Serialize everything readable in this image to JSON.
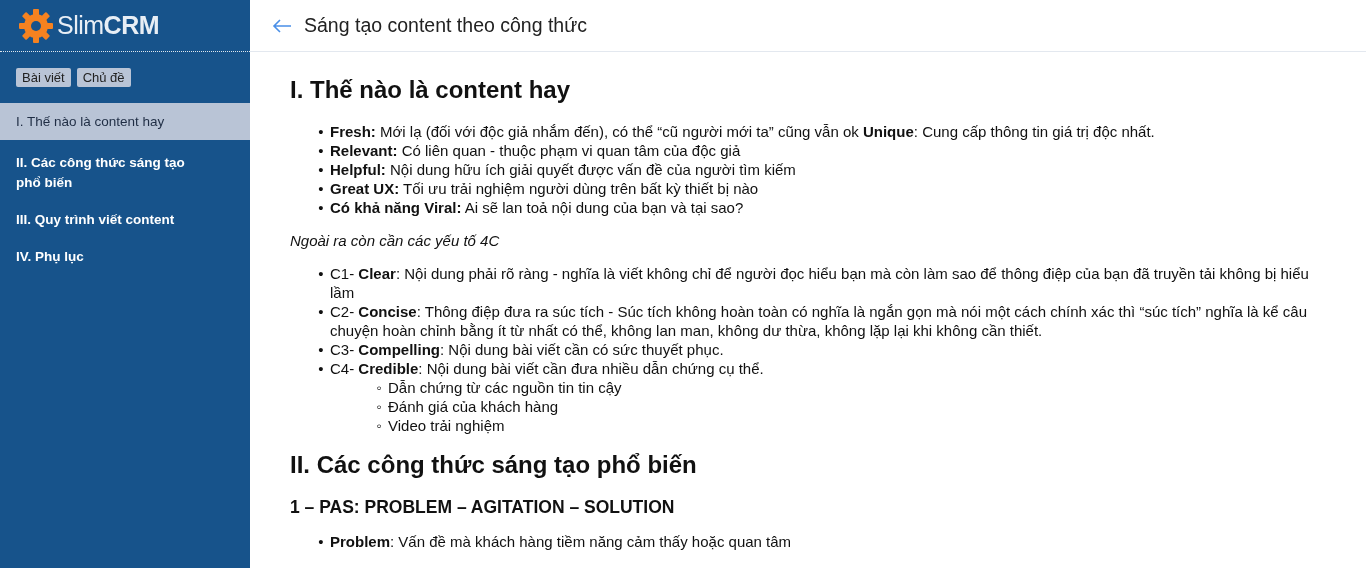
{
  "sidebar": {
    "logo": {
      "light": "Slim",
      "bold": "CRM"
    },
    "tabs": [
      {
        "label": "Bài viết"
      },
      {
        "label": "Chủ đề"
      }
    ],
    "items": [
      {
        "label": "I. Thế nào là content hay",
        "selected": true
      },
      {
        "label": "II. Các công thức sáng tạo phổ biến",
        "selected": false
      },
      {
        "label": "III. Quy trình viết content",
        "selected": false
      },
      {
        "label": "IV. Phụ lục",
        "selected": false
      }
    ]
  },
  "header": {
    "title": "Sáng tạo content theo công thức"
  },
  "content": [
    {
      "kind": "h1",
      "text": "I. Thế nào là content hay"
    },
    {
      "kind": "list",
      "items": [
        {
          "marker": "•",
          "text": "**Fresh:** Mới lạ (đối với độc giả nhắm đến), có thể “cũ người mới ta” cũng vẫn ok **Unique**: Cung cấp thông tin giá trị độc nhất."
        },
        {
          "marker": "•",
          "text": "**Relevant:** Có liên quan - thuộc phạm vi quan tâm của độc giả"
        },
        {
          "marker": "•",
          "text": "**Helpful:** Nội dung hữu ích giải quyết được vấn đề của người tìm kiếm"
        },
        {
          "marker": "•",
          "text": "**Great UX:** Tối ưu trải nghiệm người dùng trên bất kỳ thiết bị nào"
        },
        {
          "marker": "•",
          "text": "**Có khả năng Viral:** Ai sẽ lan toả nội dung của bạn và tại sao?"
        }
      ]
    },
    {
      "kind": "note",
      "text": "Ngoài ra còn cần các yếu tố 4C"
    },
    {
      "kind": "list",
      "items": [
        {
          "marker": "•",
          "text": "C1- **Clear**:  Nội dung phải rõ ràng - nghĩa là viết không chỉ để người đọc hiểu bạn mà còn làm sao để thông điệp của bạn đã truyền tải không bị hiểu lầm"
        },
        {
          "marker": "•",
          "text": "C2- **Concise**: Thông điệp đưa ra súc tích - Súc tích không hoàn toàn có nghĩa là ngắn gọn mà nói một cách chính xác thì “súc tích” nghĩa là kể câu chuyện hoàn chỉnh bằng ít từ nhất có thể, không lan man, không dư thừa, không lặp lại khi không cần thiết."
        },
        {
          "marker": "•",
          "text": "C3- **Compelling**: Nội dung bài viết cần có sức thuyết phục."
        },
        {
          "marker": "•",
          "text": "C4- **Credible**: Nội dung bài viết cần đưa nhiều dẫn chứng cụ thể.",
          "children": [
            {
              "marker": "◦",
              "text": "Dẫn chứng từ các nguồn tin tin cậy"
            },
            {
              "marker": "◦",
              "text": "Đánh giá của khách hàng"
            },
            {
              "marker": "◦",
              "text": "Video trải nghiệm"
            }
          ]
        }
      ]
    },
    {
      "kind": "h1",
      "text": "II. Các công thức sáng tạo phổ biến"
    },
    {
      "kind": "h2",
      "text": "1 – PAS: PROBLEM – AGITATION – SOLUTION"
    },
    {
      "kind": "list",
      "items": [
        {
          "marker": "•",
          "text": "**Problem**: Vấn đề mà khách hàng tiềm năng cảm thấy hoặc quan tâm"
        }
      ]
    }
  ]
}
